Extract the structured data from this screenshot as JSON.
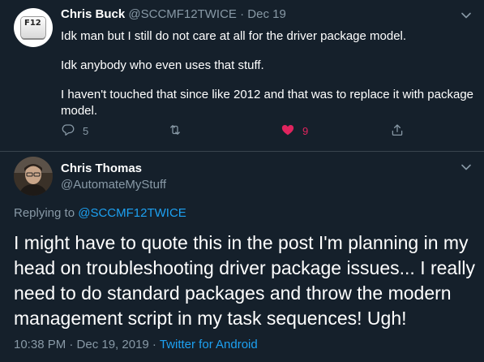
{
  "tweet1": {
    "name": "Chris Buck",
    "handle": "@SCCMF12TWICE",
    "dot": "·",
    "date": "Dec 19",
    "avatar_key": "F12",
    "paragraphs": [
      "Idk man but I still do not care at all for the driver package model.",
      "Idk anybody who even uses that stuff.",
      "I haven't touched that since like 2012 and that was to replace it with package model."
    ],
    "actions": {
      "reply_count": "5",
      "retweet_count": "",
      "like_count": "9"
    }
  },
  "tweet2": {
    "name": "Chris Thomas",
    "handle": "@AutomateMyStuff",
    "replying_prefix": "Replying to",
    "replying_to": "@SCCMF12TWICE",
    "body": "I might have to quote this in the post I'm planning in my head on troubleshooting driver package issues... I really need to do standard packages and throw the modern management script in my task sequences! Ugh!",
    "time": "10:38 PM · Dec 19, 2019 ·",
    "source": "Twitter for Android"
  },
  "colors": {
    "background": "#15202b",
    "muted": "#8899a6",
    "link": "#1da1f2",
    "like": "#e0245e",
    "divider": "#38444d"
  },
  "icons": [
    "chevron-down-icon",
    "reply-icon",
    "retweet-icon",
    "heart-icon",
    "share-icon"
  ]
}
